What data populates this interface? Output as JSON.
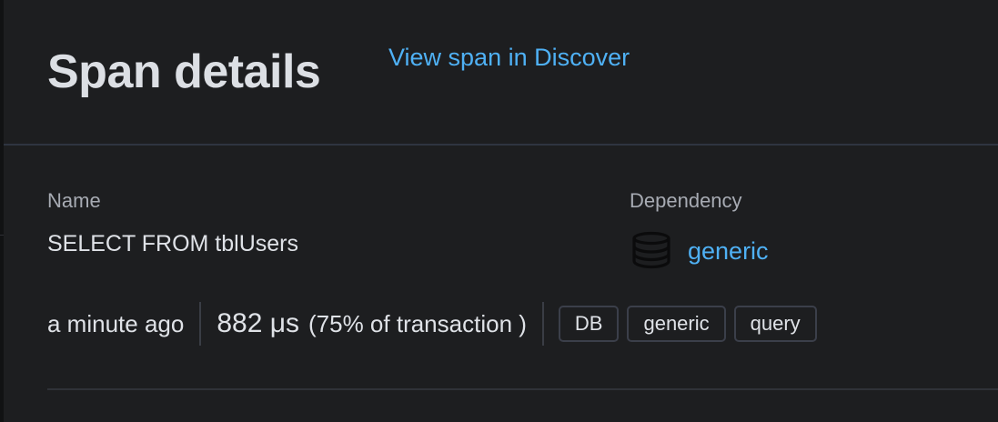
{
  "header": {
    "title": "Span details",
    "discover_link": "View span in Discover"
  },
  "details": {
    "name_label": "Name",
    "name_value": "SELECT FROM tblUsers",
    "dependency_label": "Dependency",
    "dependency_value": "generic",
    "dependency_icon": "database-icon"
  },
  "meta": {
    "time_ago": "a minute ago",
    "duration": "882 μs",
    "transaction_pct": "(75% of transaction )",
    "badges": [
      "DB",
      "generic",
      "query"
    ]
  },
  "colors": {
    "background": "#1d1e20",
    "link": "#4fb1f5",
    "title": "#dcdfe4",
    "text": "#dfe2e7",
    "muted": "#a7abb3",
    "badge_border": "#3b3f4a"
  }
}
